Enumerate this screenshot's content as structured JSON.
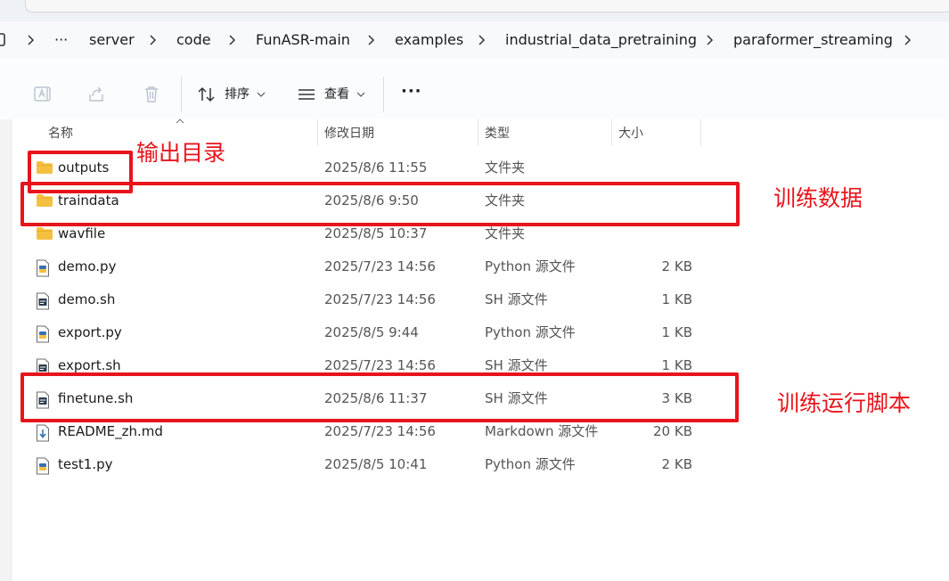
{
  "breadcrumb": {
    "overflow": "···",
    "items": [
      "server",
      "code",
      "FunASR-main",
      "examples",
      "industrial_data_pretraining",
      "paraformer_streaming"
    ]
  },
  "toolbar": {
    "sort_label": "排序",
    "view_label": "查看",
    "more_label": "···"
  },
  "columns": {
    "name": "名称",
    "modified": "修改日期",
    "type": "类型",
    "size": "大小"
  },
  "files": [
    {
      "name": "outputs",
      "date": "2025/8/6 11:55",
      "type": "文件夹",
      "size": "",
      "icon": "folder-icon"
    },
    {
      "name": "traindata",
      "date": "2025/8/6 9:50",
      "type": "文件夹",
      "size": "",
      "icon": "folder-icon"
    },
    {
      "name": "wavfile",
      "date": "2025/8/5 10:37",
      "type": "文件夹",
      "size": "",
      "icon": "folder-icon"
    },
    {
      "name": "demo.py",
      "date": "2025/7/23 14:56",
      "type": "Python 源文件",
      "size": "2 KB",
      "icon": "python-file-icon"
    },
    {
      "name": "demo.sh",
      "date": "2025/7/23 14:56",
      "type": "SH 源文件",
      "size": "1 KB",
      "icon": "shell-file-icon"
    },
    {
      "name": "export.py",
      "date": "2025/8/5 9:44",
      "type": "Python 源文件",
      "size": "1 KB",
      "icon": "python-file-icon"
    },
    {
      "name": "export.sh",
      "date": "2025/7/23 14:56",
      "type": "SH 源文件",
      "size": "1 KB",
      "icon": "shell-file-icon"
    },
    {
      "name": "finetune.sh",
      "date": "2025/8/6 11:37",
      "type": "SH 源文件",
      "size": "3 KB",
      "icon": "shell-file-icon"
    },
    {
      "name": "README_zh.md",
      "date": "2025/7/23 14:56",
      "type": "Markdown 源文件",
      "size": "20 KB",
      "icon": "markdown-file-icon"
    },
    {
      "name": "test1.py",
      "date": "2025/8/5 10:41",
      "type": "Python 源文件",
      "size": "2 KB",
      "icon": "python-file-icon"
    }
  ],
  "annotations": {
    "outputs": "输出目录",
    "traindata": "训练数据",
    "finetune": "训练运行脚本"
  },
  "colors": {
    "annotation": "#e8141c",
    "folder": "#f4c042"
  }
}
